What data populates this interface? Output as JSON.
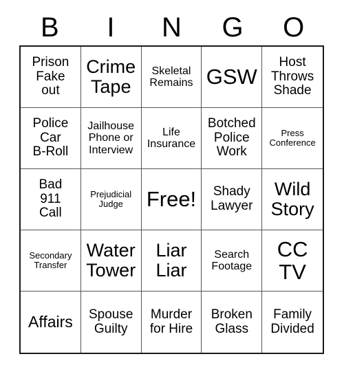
{
  "card": {
    "header": {
      "letters": [
        "B",
        "I",
        "N",
        "G",
        "O"
      ]
    },
    "colors": {
      "text": "#000000",
      "outer_border": "#1a1a1a",
      "inner_border": "#555555",
      "background": "#ffffff"
    },
    "cells": [
      {
        "text": "Prison\nFake\nout",
        "size": "m",
        "free": false
      },
      {
        "text": "Crime\nTape",
        "size": "xl",
        "free": false
      },
      {
        "text": "Skeletal\nRemains",
        "size": "s",
        "free": false
      },
      {
        "text": "GSW",
        "size": "xxl",
        "free": false
      },
      {
        "text": "Host\nThrows\nShade",
        "size": "m",
        "free": false
      },
      {
        "text": "Police\nCar\nB-Roll",
        "size": "m",
        "free": false
      },
      {
        "text": "Jailhouse\nPhone or\nInterview",
        "size": "s",
        "free": false
      },
      {
        "text": "Life\nInsurance",
        "size": "s",
        "free": false
      },
      {
        "text": "Botched\nPolice\nWork",
        "size": "m",
        "free": false
      },
      {
        "text": "Press\nConference",
        "size": "xs",
        "free": false
      },
      {
        "text": "Bad\n911\nCall",
        "size": "m",
        "free": false
      },
      {
        "text": "Prejudicial\nJudge",
        "size": "xs",
        "free": false
      },
      {
        "text": "Free!",
        "size": "xxl",
        "free": true
      },
      {
        "text": "Shady\nLawyer",
        "size": "m",
        "free": false
      },
      {
        "text": "Wild\nStory",
        "size": "xl",
        "free": false
      },
      {
        "text": "Secondary\nTransfer",
        "size": "xs",
        "free": false
      },
      {
        "text": "Water\nTower",
        "size": "xl",
        "free": false
      },
      {
        "text": "Liar\nLiar",
        "size": "xl",
        "free": false
      },
      {
        "text": "Search\nFootage",
        "size": "s",
        "free": false
      },
      {
        "text": "CC\nTV",
        "size": "xxl",
        "free": false
      },
      {
        "text": "Affairs",
        "size": "l",
        "free": false
      },
      {
        "text": "Spouse\nGuilty",
        "size": "m",
        "free": false
      },
      {
        "text": "Murder\nfor Hire",
        "size": "m",
        "free": false
      },
      {
        "text": "Broken\nGlass",
        "size": "m",
        "free": false
      },
      {
        "text": "Family\nDivided",
        "size": "m",
        "free": false
      }
    ]
  }
}
